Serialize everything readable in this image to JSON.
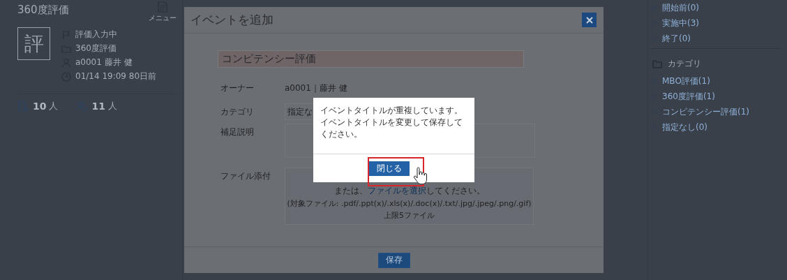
{
  "left_card": {
    "title": "360度評価",
    "menu_label": "メニュー",
    "avatar_char": "評",
    "details": [
      {
        "kind": "status",
        "text": "評価入力中"
      },
      {
        "kind": "category",
        "text": "360度評価"
      },
      {
        "kind": "owner",
        "text": "a0001 藤井 健"
      },
      {
        "kind": "time",
        "text": "01/14 19:09 80日前"
      }
    ],
    "counts": [
      {
        "kind": "evaluatees",
        "value": "10",
        "unit": "人"
      },
      {
        "kind": "evaluators",
        "value": "11",
        "unit": "人"
      }
    ]
  },
  "sidebar": {
    "status_items": [
      "開始前(0)",
      "実施中(3)",
      "終了(0)"
    ],
    "category_heading": "カテゴリ",
    "category_items": [
      "MBO評価(1)",
      "360度評価(1)",
      "コンピテンシー評価(1)",
      "指定なし(0)"
    ]
  },
  "modal": {
    "title": "イベントを追加",
    "event_title": "コンピテンシー評価",
    "fields": [
      {
        "kind": "text",
        "label": "オーナー",
        "value": "a0001｜藤井 健"
      },
      {
        "kind": "select",
        "label": "カテゴリ",
        "value": "指定な"
      },
      {
        "kind": "textarea",
        "label": "補足説明"
      },
      {
        "kind": "file",
        "label": "ファイル添付",
        "lines": [
          "または、**ファイルを選択**してください。",
          "(対象ファイル: .pdf/.ppt(x)/.xls(x)/.doc(x)/.txt/.jpg/.jpeg/.png/.gif)",
          "上限5ファイル"
        ]
      }
    ],
    "save_label": "保存"
  },
  "alert": {
    "message": "イベントタイトルが重複しています。イベントタイトルを変更して保存してください。",
    "button": "閉じる",
    "highlighted": true
  }
}
